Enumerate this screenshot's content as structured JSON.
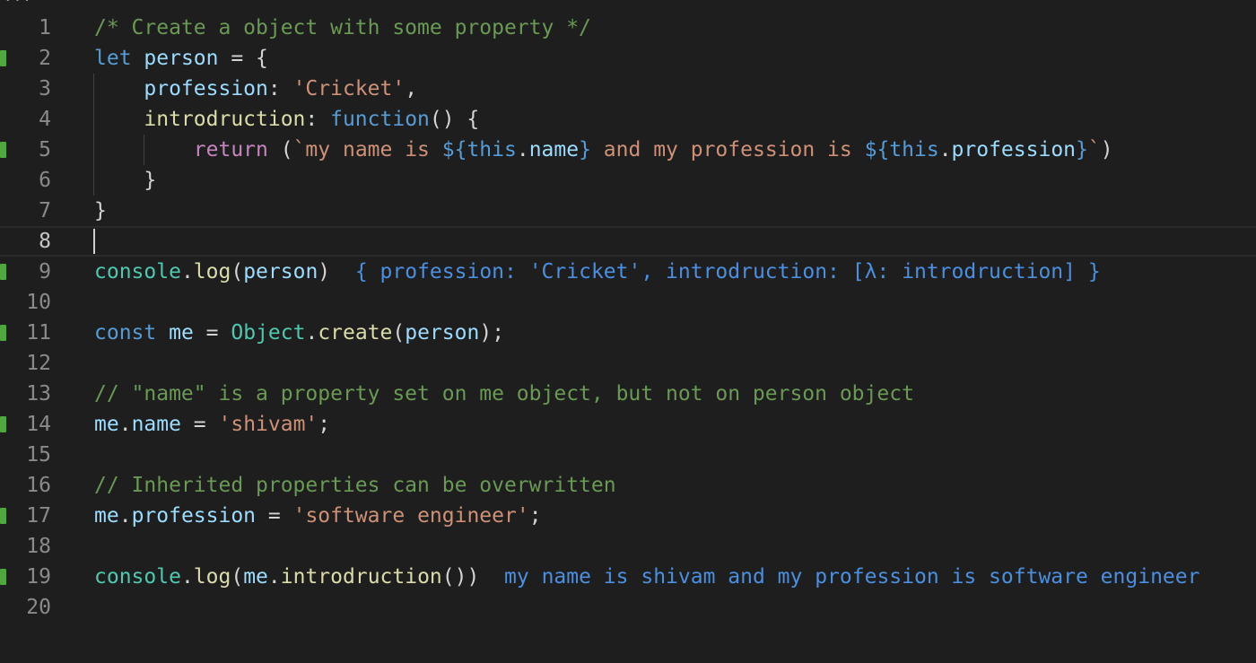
{
  "editor": {
    "top_ellipsis": "...",
    "active_line": 8,
    "lines": [
      {
        "n": "1",
        "segments": [
          {
            "t": "/* Create a object with some property */",
            "c": "comment"
          }
        ]
      },
      {
        "n": "2",
        "modified": true,
        "segments": [
          {
            "t": "let",
            "c": "kw"
          },
          {
            "t": " ",
            "c": "punc"
          },
          {
            "t": "person",
            "c": "var"
          },
          {
            "t": " = {",
            "c": "punc"
          }
        ]
      },
      {
        "n": "3",
        "segments": [
          {
            "t": "    ",
            "c": "punc"
          },
          {
            "t": "profession",
            "c": "var"
          },
          {
            "t": ": ",
            "c": "punc"
          },
          {
            "t": "'Cricket'",
            "c": "str"
          },
          {
            "t": ",",
            "c": "punc"
          }
        ]
      },
      {
        "n": "4",
        "segments": [
          {
            "t": "    ",
            "c": "punc"
          },
          {
            "t": "introdruction",
            "c": "fn"
          },
          {
            "t": ": ",
            "c": "punc"
          },
          {
            "t": "function",
            "c": "kw"
          },
          {
            "t": "() {",
            "c": "punc"
          }
        ]
      },
      {
        "n": "5",
        "modified": true,
        "segments": [
          {
            "t": "        ",
            "c": "punc"
          },
          {
            "t": "return",
            "c": "ctl"
          },
          {
            "t": " (",
            "c": "punc"
          },
          {
            "t": "`my name is ",
            "c": "str"
          },
          {
            "t": "${",
            "c": "tpl"
          },
          {
            "t": "this",
            "c": "kw"
          },
          {
            "t": ".",
            "c": "punc"
          },
          {
            "t": "name",
            "c": "var"
          },
          {
            "t": "}",
            "c": "tpl"
          },
          {
            "t": " and my profession is ",
            "c": "str"
          },
          {
            "t": "${",
            "c": "tpl"
          },
          {
            "t": "this",
            "c": "kw"
          },
          {
            "t": ".",
            "c": "punc"
          },
          {
            "t": "profession",
            "c": "var"
          },
          {
            "t": "}",
            "c": "tpl"
          },
          {
            "t": "`",
            "c": "str"
          },
          {
            "t": ")",
            "c": "punc"
          }
        ]
      },
      {
        "n": "6",
        "segments": [
          {
            "t": "    }",
            "c": "punc"
          }
        ]
      },
      {
        "n": "7",
        "segments": [
          {
            "t": "}",
            "c": "punc"
          }
        ]
      },
      {
        "n": "8",
        "segments": []
      },
      {
        "n": "9",
        "modified": true,
        "segments": [
          {
            "t": "console",
            "c": "obj"
          },
          {
            "t": ".",
            "c": "punc"
          },
          {
            "t": "log",
            "c": "fn"
          },
          {
            "t": "(",
            "c": "punc"
          },
          {
            "t": "person",
            "c": "var"
          },
          {
            "t": ")",
            "c": "punc"
          },
          {
            "t": "  { profession: 'Cricket', introdruction: [λ: introdruction] }",
            "c": "res"
          }
        ]
      },
      {
        "n": "10",
        "segments": []
      },
      {
        "n": "11",
        "modified": true,
        "segments": [
          {
            "t": "const",
            "c": "kw"
          },
          {
            "t": " ",
            "c": "punc"
          },
          {
            "t": "me",
            "c": "var"
          },
          {
            "t": " = ",
            "c": "punc"
          },
          {
            "t": "Object",
            "c": "obj"
          },
          {
            "t": ".",
            "c": "punc"
          },
          {
            "t": "create",
            "c": "fn"
          },
          {
            "t": "(",
            "c": "punc"
          },
          {
            "t": "person",
            "c": "var"
          },
          {
            "t": ");",
            "c": "punc"
          }
        ]
      },
      {
        "n": "12",
        "segments": []
      },
      {
        "n": "13",
        "segments": [
          {
            "t": "// \"name\" is a property set on me object, but not on person object",
            "c": "comment"
          }
        ]
      },
      {
        "n": "14",
        "modified": true,
        "segments": [
          {
            "t": "me",
            "c": "var"
          },
          {
            "t": ".",
            "c": "punc"
          },
          {
            "t": "name",
            "c": "var"
          },
          {
            "t": " = ",
            "c": "punc"
          },
          {
            "t": "'shivam'",
            "c": "str"
          },
          {
            "t": ";",
            "c": "punc"
          }
        ]
      },
      {
        "n": "15",
        "segments": []
      },
      {
        "n": "16",
        "segments": [
          {
            "t": "// Inherited properties can be overwritten",
            "c": "comment"
          }
        ]
      },
      {
        "n": "17",
        "modified": true,
        "segments": [
          {
            "t": "me",
            "c": "var"
          },
          {
            "t": ".",
            "c": "punc"
          },
          {
            "t": "profession",
            "c": "var"
          },
          {
            "t": " = ",
            "c": "punc"
          },
          {
            "t": "'software engineer'",
            "c": "str"
          },
          {
            "t": ";",
            "c": "punc"
          }
        ]
      },
      {
        "n": "18",
        "segments": []
      },
      {
        "n": "19",
        "modified": true,
        "segments": [
          {
            "t": "console",
            "c": "obj"
          },
          {
            "t": ".",
            "c": "punc"
          },
          {
            "t": "log",
            "c": "fn"
          },
          {
            "t": "(",
            "c": "punc"
          },
          {
            "t": "me",
            "c": "var"
          },
          {
            "t": ".",
            "c": "punc"
          },
          {
            "t": "introdruction",
            "c": "fn"
          },
          {
            "t": "())",
            "c": "punc"
          },
          {
            "t": "  my name is shivam and my profession is software engineer",
            "c": "res"
          }
        ]
      },
      {
        "n": "20",
        "segments": []
      }
    ]
  }
}
